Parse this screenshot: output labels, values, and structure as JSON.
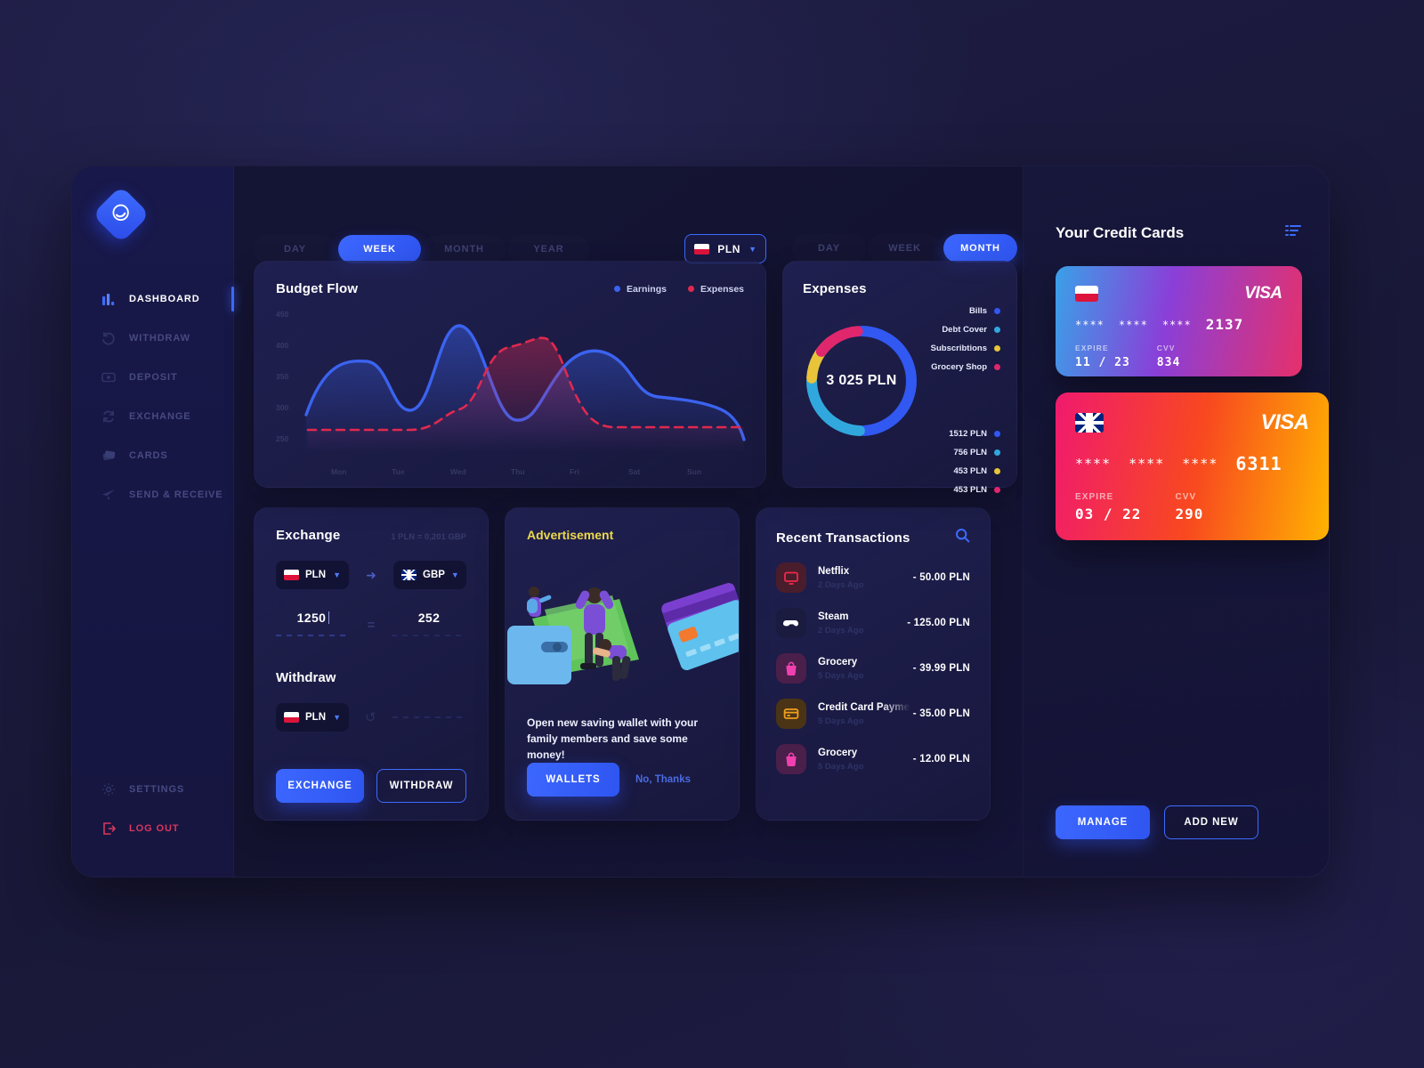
{
  "brand": {
    "logo_icon": "swirl-logo-icon"
  },
  "sidebar": {
    "items": [
      {
        "label": "DASHBOARD",
        "icon": "bar-chart-icon",
        "active": true
      },
      {
        "label": "WITHDRAW",
        "icon": "undo-arrow-icon",
        "active": false
      },
      {
        "label": "DEPOSIT",
        "icon": "money-icon",
        "active": false
      },
      {
        "label": "EXCHANGE",
        "icon": "refresh-circle-icon",
        "active": false
      },
      {
        "label": "CARDS",
        "icon": "cards-icon",
        "active": false
      },
      {
        "label": "SEND & RECEIVE",
        "icon": "send-plane-icon",
        "active": false
      }
    ],
    "bottom": [
      {
        "label": "SETTINGS",
        "icon": "gear-icon"
      },
      {
        "label": "LOG OUT",
        "icon": "logout-icon"
      }
    ]
  },
  "budget_toolbar": {
    "tabs": [
      {
        "label": "DAY",
        "active": false
      },
      {
        "label": "WEEK",
        "active": true
      },
      {
        "label": "MONTH",
        "active": false
      },
      {
        "label": "YEAR",
        "active": false
      }
    ],
    "currency": {
      "code": "PLN",
      "flag": "poland-flag-icon",
      "chevron": "chevron-down-icon"
    }
  },
  "expenses_toolbar": {
    "tabs": [
      {
        "label": "DAY",
        "active": false
      },
      {
        "label": "WEEK",
        "active": false
      },
      {
        "label": "MONTH",
        "active": true
      }
    ]
  },
  "budget_flow": {
    "title": "Budget Flow",
    "legend": [
      {
        "label": "Earnings",
        "color": "#3b63f0"
      },
      {
        "label": "Expenses",
        "color": "#e0294f"
      }
    ]
  },
  "expenses": {
    "title": "Expenses",
    "center_total": "3 025 PLN",
    "legend": [
      {
        "label": "Bills",
        "color": "#3258f2"
      },
      {
        "label": "Debt Cover",
        "color": "#31a8dd"
      },
      {
        "label": "Subscribtions",
        "color": "#e8c43a"
      },
      {
        "label": "Grocery Shop",
        "color": "#e0266d"
      }
    ],
    "values": [
      {
        "label": "1512 PLN",
        "color": "#3258f2"
      },
      {
        "label": "756 PLN",
        "color": "#31a8dd"
      },
      {
        "label": "453 PLN",
        "color": "#e8c43a"
      },
      {
        "label": "453 PLN",
        "color": "#e0266d"
      }
    ]
  },
  "exchange": {
    "title": "Exchange",
    "rate": "1 PLN = 0,201 GBP",
    "from": {
      "code": "PLN",
      "flag": "poland-flag-icon"
    },
    "to": {
      "code": "GBP",
      "flag": "uk-flag-icon"
    },
    "arrow_icon": "arrow-right-icon",
    "from_amount": "1250",
    "equals": "=",
    "to_amount": "252",
    "withdraw_title": "Withdraw",
    "withdraw_currency": {
      "code": "PLN",
      "flag": "poland-flag-icon"
    },
    "refresh_icon": "refresh-icon",
    "exchange_button": "EXCHANGE",
    "withdraw_button": "WITHDRAW"
  },
  "advertisement": {
    "title": "Advertisement",
    "body": "Open new saving wallet with your family members and save some money!",
    "primary_button": "WALLETS",
    "secondary_link": "No, Thanks",
    "art_icon": "wallet-people-illustration"
  },
  "transactions": {
    "title": "Recent Transactions",
    "search_icon": "search-icon",
    "items": [
      {
        "name": "Netflix",
        "date": "2 Days Ago",
        "amount": "- 50.00 PLN",
        "icon": "tv-icon",
        "icon_bg": "#4a1d2c",
        "icon_color": "#f0294a",
        "truncated": false
      },
      {
        "name": "Steam",
        "date": "2 Days Ago",
        "amount": "- 125.00 PLN",
        "icon": "gamepad-icon",
        "icon_bg": "#1a1b3f",
        "icon_color": "#ffffff",
        "truncated": false
      },
      {
        "name": "Grocery",
        "date": "5 Days Ago",
        "amount": "- 39.99 PLN",
        "icon": "shopping-bag-icon",
        "icon_bg": "#4a1f4a",
        "icon_color": "#f040b0",
        "truncated": false
      },
      {
        "name": "Credit Card Payment",
        "date": "5 Days Ago",
        "amount": "- 35.00 PLN",
        "icon": "credit-card-icon",
        "icon_bg": "#4a3415",
        "icon_color": "#f0a020",
        "truncated": true
      },
      {
        "name": "Grocery",
        "date": "5 Days Ago",
        "amount": "- 12.00 PLN",
        "icon": "shopping-bag-icon",
        "icon_bg": "#4a1f4a",
        "icon_color": "#f040b0",
        "truncated": false
      }
    ]
  },
  "credit_cards": {
    "title": "Your Credit Cards",
    "sort_icon": "sort-lines-icon",
    "cards": [
      {
        "flag": "poland-flag-icon",
        "brand": "VISA",
        "masked": [
          "****",
          "****",
          "****"
        ],
        "last4": "2137",
        "expire_label": "EXPIRE",
        "expire": "11 / 23",
        "cvv_label": "CVV",
        "cvv": "834"
      },
      {
        "flag": "uk-flag-icon",
        "brand": "VISA",
        "masked": [
          "****",
          "****",
          "****"
        ],
        "last4": "6311",
        "expire_label": "EXPIRE",
        "expire": "03 / 22",
        "cvv_label": "CVV",
        "cvv": "290"
      }
    ],
    "manage_button": "MANAGE",
    "add_button": "ADD NEW"
  },
  "chart_data": [
    {
      "type": "line",
      "title": "Budget Flow",
      "xlabel": "",
      "ylabel": "",
      "categories": [
        "Mon",
        "Tue",
        "Wed",
        "Thu",
        "Fri",
        "Sat",
        "Sun"
      ],
      "ticks": [
        "450",
        "400",
        "350",
        "300",
        "250"
      ],
      "ylim": [
        250,
        450
      ],
      "grid": false,
      "legend_position": "top-right",
      "series": [
        {
          "name": "Earnings",
          "color": "#3b63f0",
          "style": "solid",
          "values": [
            315,
            360,
            305,
            430,
            290,
            350,
            320
          ]
        },
        {
          "name": "Expenses",
          "color": "#e0294f",
          "style": "dashed",
          "values": [
            275,
            275,
            275,
            280,
            405,
            277,
            275
          ]
        }
      ]
    },
    {
      "type": "pie",
      "title": "Expenses",
      "center_label": "3 025 PLN",
      "labels": [
        "Bills",
        "Debt Cover",
        "Subscribtions",
        "Grocery Shop"
      ],
      "values": [
        1512,
        756,
        453,
        453
      ],
      "unit": "PLN",
      "colors": [
        "#3258f2",
        "#31a8dd",
        "#e8c43a",
        "#e0266d"
      ],
      "legend_position": "right"
    }
  ]
}
